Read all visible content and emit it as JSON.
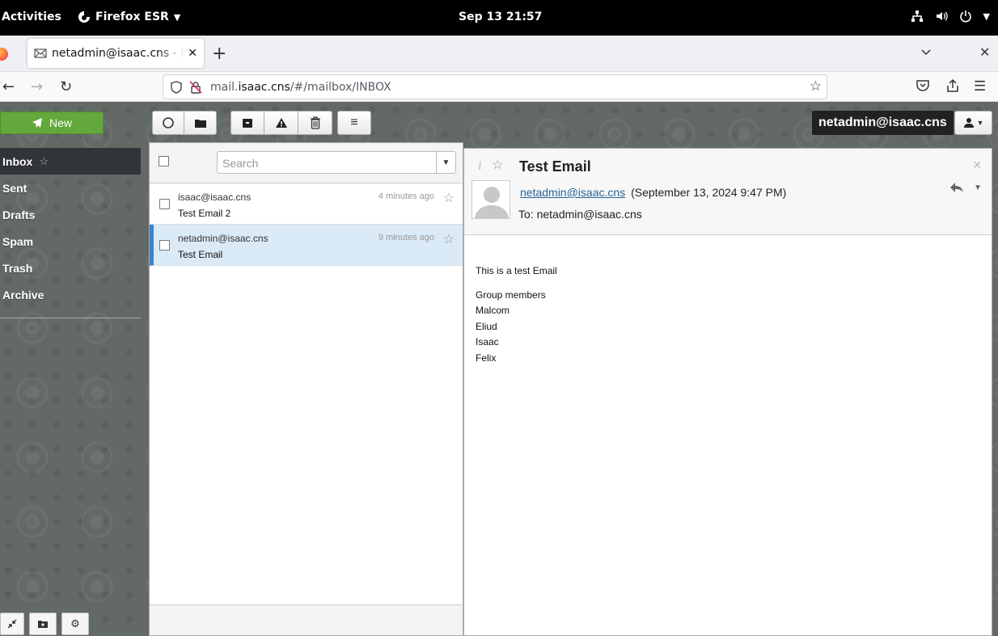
{
  "system_bar": {
    "activities": "Activities",
    "app_menu": "Firefox ESR",
    "clock": "Sep 13  21:57"
  },
  "browser": {
    "tab_title": "netadmin@isaac.cns - Mail",
    "url_prefix": "mail.",
    "url_host": "isaac.cns",
    "url_path": "/#/mailbox/INBOX"
  },
  "toolbar": {
    "new_label": "New"
  },
  "folders": [
    {
      "label": "Inbox"
    },
    {
      "label": "Sent"
    },
    {
      "label": "Drafts"
    },
    {
      "label": "Spam"
    },
    {
      "label": "Trash"
    },
    {
      "label": "Archive"
    }
  ],
  "account": {
    "email": "netadmin@isaac.cns"
  },
  "message_list": {
    "search_placeholder": "Search",
    "messages": [
      {
        "from": "isaac@isaac.cns",
        "subject": "Test Email 2",
        "date": "4 minutes ago",
        "selected": false
      },
      {
        "from": "netadmin@isaac.cns",
        "subject": "Test Email",
        "date": "9 minutes ago",
        "selected": true
      }
    ]
  },
  "message_view": {
    "subject": "Test Email",
    "from": "netadmin@isaac.cns",
    "date": "(September 13, 2024 9:47 PM)",
    "to": "To: netadmin@isaac.cns",
    "body_lines": [
      "This is a test Email",
      "Group members",
      "Malcom",
      "Eliud",
      "Isaac",
      "Felix"
    ]
  },
  "colors": {
    "new_button": "#62a83a",
    "selected_row": "#dbeaf7",
    "selected_accent": "#3c84cc",
    "link": "#2a6496"
  }
}
